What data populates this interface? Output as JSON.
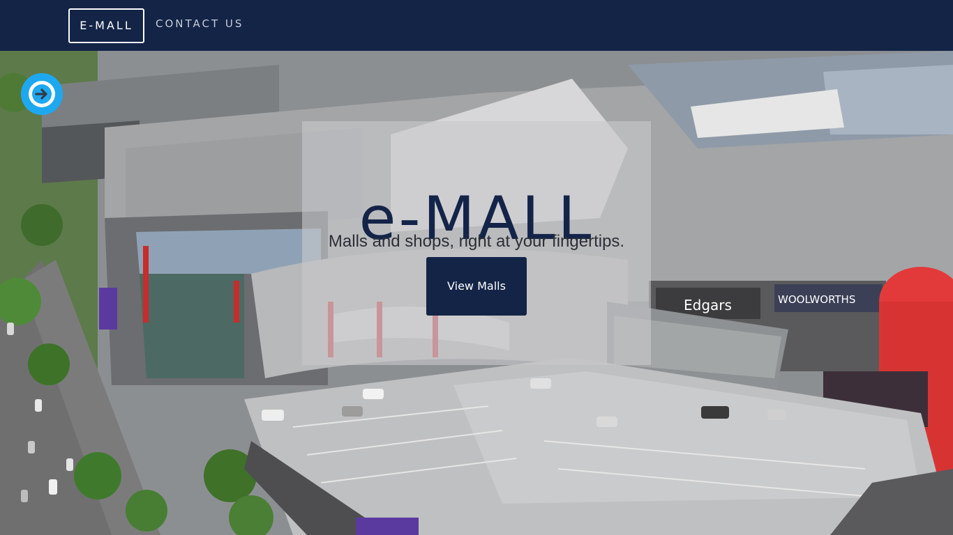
{
  "navbar": {
    "brand_label": "E-MALL",
    "contact_label": "CONTACT US",
    "background_color": "#132447"
  },
  "hero": {
    "title": "e-MALL",
    "tagline": "Malls and shops, right at your fingertips.",
    "cta_label": "View Malls",
    "background_image": "aerial-view-of-shopping-mall",
    "storefront_signs": [
      "Edgars",
      "WOOLWORTHS"
    ]
  },
  "floating_button": {
    "icon": "arrow-right-icon",
    "color": "#1ea8f0"
  },
  "colors": {
    "navy": "#132447",
    "accent_blue": "#1ea8f0",
    "panel_overlay": "rgba(200,200,204,0.62)"
  }
}
